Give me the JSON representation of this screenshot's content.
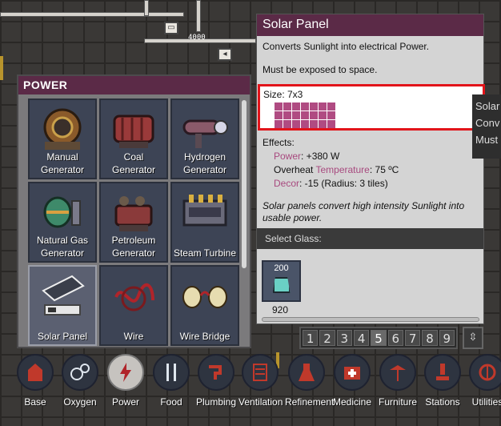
{
  "world": {
    "meter_value": "4000"
  },
  "power_panel": {
    "title": "POWER",
    "items": [
      {
        "label": "Manual Generator",
        "icon": "manual-generator-icon"
      },
      {
        "label": "Coal Generator",
        "icon": "coal-generator-icon"
      },
      {
        "label": "Hydrogen Generator",
        "icon": "hydrogen-generator-icon"
      },
      {
        "label": "Natural Gas Generator",
        "icon": "natural-gas-generator-icon"
      },
      {
        "label": "Petroleum Generator",
        "icon": "petroleum-generator-icon"
      },
      {
        "label": "Steam Turbine",
        "icon": "steam-turbine-icon"
      },
      {
        "label": "Solar Panel",
        "icon": "solar-panel-icon",
        "selected": true
      },
      {
        "label": "Wire",
        "icon": "wire-icon"
      },
      {
        "label": "Wire Bridge",
        "icon": "wire-bridge-icon"
      }
    ]
  },
  "info": {
    "title": "Solar Panel",
    "description": "Converts Sunlight into electrical Power.",
    "requirement": "Must be exposed to space.",
    "size_label": "Size: 7x3",
    "size_cols": 7,
    "size_rows": 3,
    "effects_label": "Effects:",
    "power_key": "Power",
    "power_val": ": +380 W",
    "overheat_prefix": "Overheat ",
    "overheat_key": "Temperature",
    "overheat_val": ": 75 ºC",
    "decor_key": "Decor",
    "decor_val": ": -15 (Radius: 3 tiles)",
    "flavor": "Solar panels convert high intensity Sunlight into usable power.",
    "select_glass": "Select Glass:",
    "glass_amount_top": "200",
    "glass_amount_bottom": "920"
  },
  "peek": {
    "line1": "Solar",
    "line2": "Conv",
    "line3": "Must"
  },
  "speed": {
    "buttons": [
      "1",
      "2",
      "3",
      "4",
      "5",
      "6",
      "7",
      "8",
      "9"
    ],
    "active": "5",
    "toggle": "⇳"
  },
  "toolbar": {
    "items": [
      {
        "label": "Base",
        "icon": "base-icon"
      },
      {
        "label": "Oxygen",
        "icon": "oxygen-icon"
      },
      {
        "label": "Power",
        "icon": "power-icon",
        "active": true
      },
      {
        "label": "Food",
        "icon": "food-icon"
      },
      {
        "label": "Plumbing",
        "icon": "plumbing-icon"
      },
      {
        "label": "Ventilation",
        "icon": "ventilation-icon"
      },
      {
        "label": "Refinement",
        "icon": "refinement-icon"
      },
      {
        "label": "Medicine",
        "icon": "medicine-icon"
      },
      {
        "label": "Furniture",
        "icon": "furniture-icon"
      },
      {
        "label": "Stations",
        "icon": "stations-icon"
      },
      {
        "label": "Utilities",
        "icon": "utilities-icon"
      }
    ]
  },
  "colors": {
    "header": "#5b2a47",
    "highlight_text": "#a84a7f",
    "size_cell": "#b04b82",
    "size_border": "#e2141a"
  }
}
